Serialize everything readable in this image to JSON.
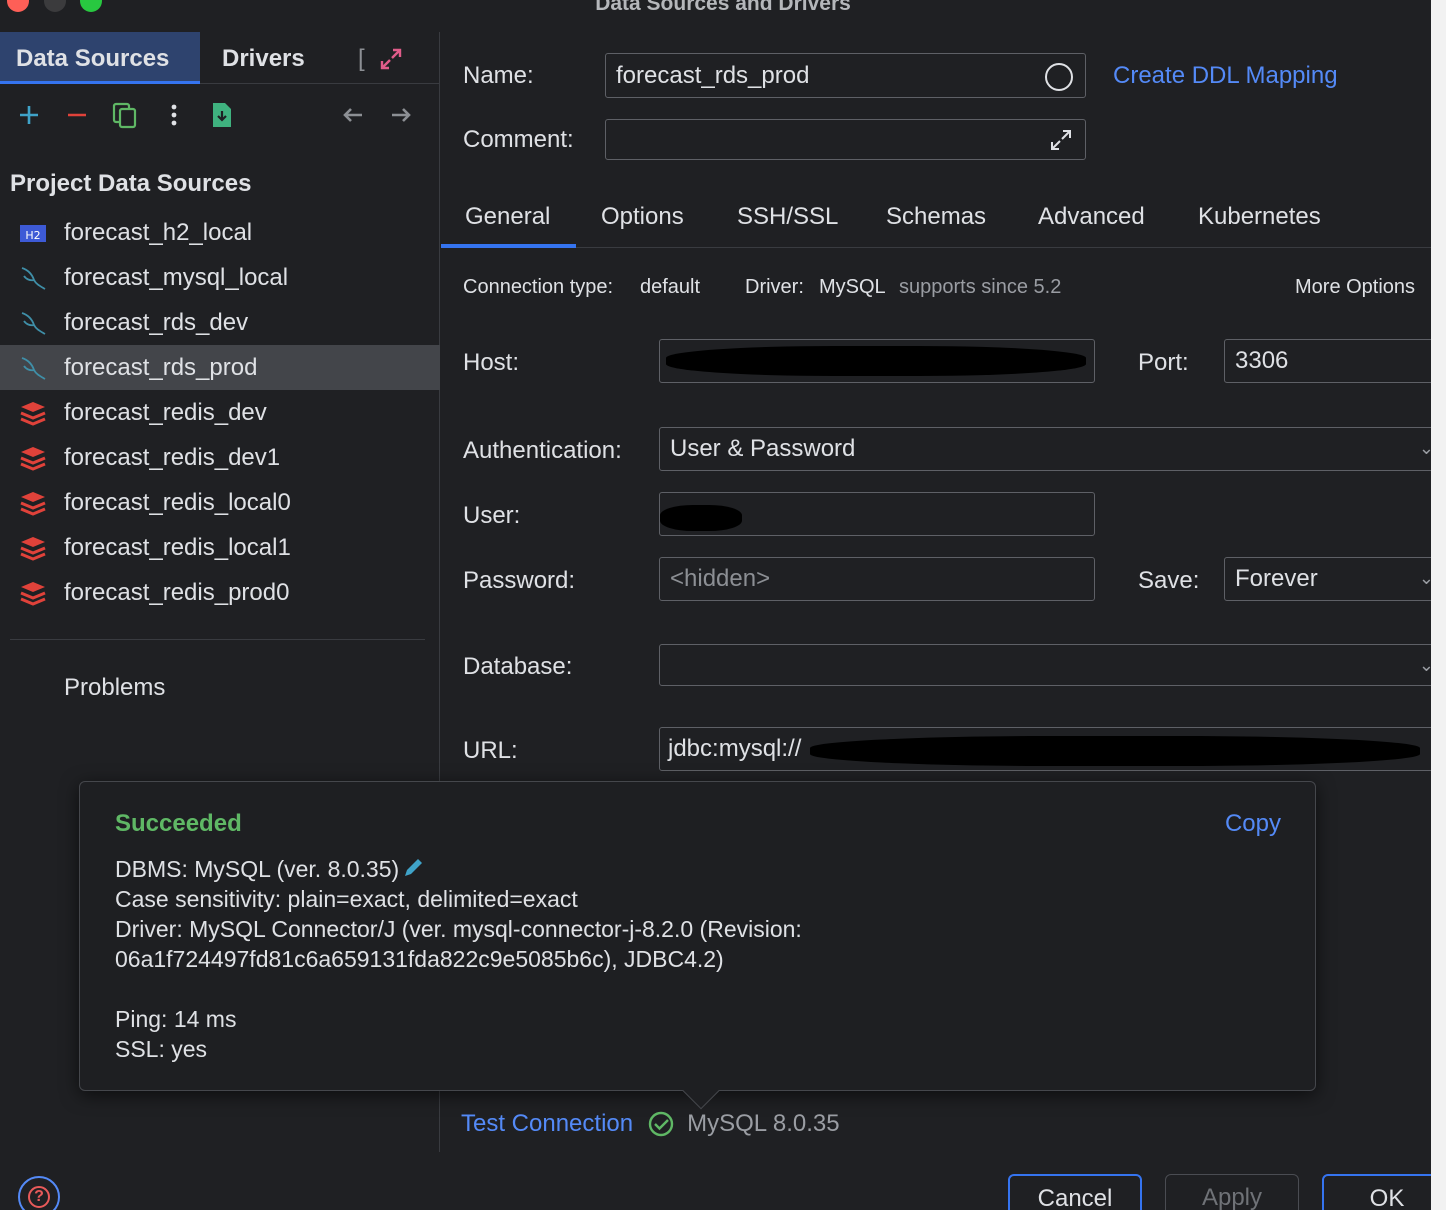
{
  "window": {
    "title": "Data Sources and Drivers"
  },
  "left_tabs": {
    "data_sources": "Data Sources",
    "drivers": "Drivers",
    "more": "["
  },
  "sidebar": {
    "section_title": "Project Data Sources",
    "items": [
      {
        "label": "forecast_h2_local",
        "icon": "h2-icon"
      },
      {
        "label": "forecast_mysql_local",
        "icon": "mysql-dolphin-icon"
      },
      {
        "label": "forecast_rds_dev",
        "icon": "mysql-dolphin-icon"
      },
      {
        "label": "forecast_rds_prod",
        "icon": "mysql-dolphin-icon",
        "selected": true
      },
      {
        "label": "forecast_redis_dev",
        "icon": "redis-icon"
      },
      {
        "label": "forecast_redis_dev1",
        "icon": "redis-icon"
      },
      {
        "label": "forecast_redis_local0",
        "icon": "redis-icon"
      },
      {
        "label": "forecast_redis_local1",
        "icon": "redis-icon"
      },
      {
        "label": "forecast_redis_prod0",
        "icon": "redis-icon"
      }
    ],
    "problems": "Problems"
  },
  "form": {
    "name_label": "Name:",
    "name_value": "forecast_rds_prod",
    "create_ddl": "Create DDL Mapping",
    "comment_label": "Comment:",
    "comment_value": "",
    "tabs": [
      "General",
      "Options",
      "SSH/SSL",
      "Schemas",
      "Advanced",
      "Kubernetes"
    ],
    "connection_type_label": "Connection type:",
    "connection_type_value": "default",
    "driver_label": "Driver:",
    "driver_value": "MySQL",
    "driver_note": "supports since 5.2",
    "more_options": "More Options",
    "host_label": "Host:",
    "port_label": "Port:",
    "port_value": "3306",
    "auth_label": "Authentication:",
    "auth_value": "User & Password",
    "user_label": "User:",
    "password_label": "Password:",
    "password_placeholder": "<hidden>",
    "save_label": "Save:",
    "save_value": "Forever",
    "database_label": "Database:",
    "database_value": "",
    "url_label": "URL:",
    "url_value": "jdbc:mysql://"
  },
  "popup": {
    "status": "Succeeded",
    "copy": "Copy",
    "dbms": "DBMS: MySQL (ver. 8.0.35)",
    "lines": "Case sensitivity: plain=exact, delimited=exact\nDriver: MySQL Connector/J (ver. mysql-connector-j-8.2.0 (Revision:\n06a1f724497fd81c6a659131fda822c9e5085b6c), JDBC4.2)\n\nPing: 14 ms\nSSL: yes"
  },
  "footer": {
    "test_connection": "Test Connection",
    "test_result": "MySQL 8.0.35",
    "cancel": "Cancel",
    "apply": "Apply",
    "ok": "OK"
  },
  "colors": {
    "accent": "#3574f0",
    "link": "#548af7",
    "success": "#5fb865",
    "redis": "#e0423a",
    "mysql": "#3f8fa8"
  }
}
